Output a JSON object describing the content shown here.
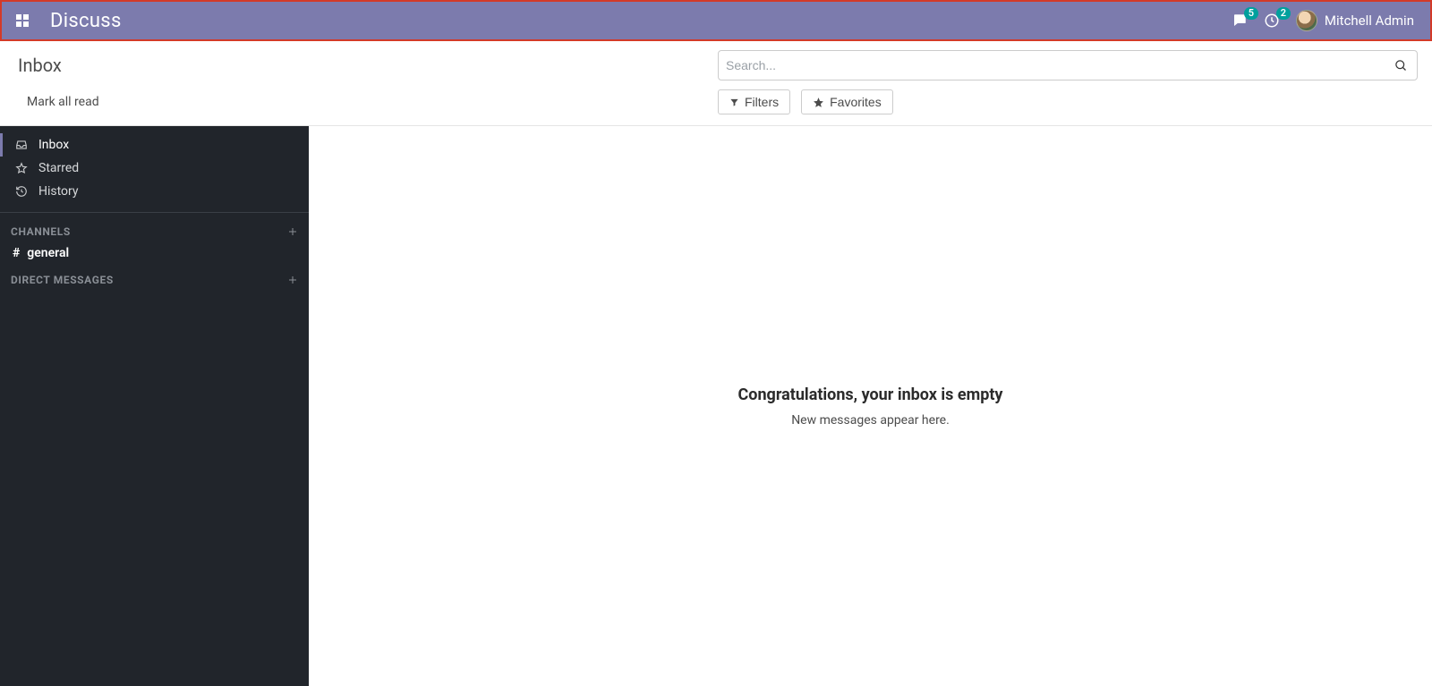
{
  "topnav": {
    "app_title": "Discuss",
    "messages_badge": "5",
    "activities_badge": "2",
    "username": "Mitchell Admin"
  },
  "control_panel": {
    "breadcrumb": "Inbox",
    "mark_all_read": "Mark all read",
    "search_placeholder": "Search...",
    "filters_label": "Filters",
    "favorites_label": "Favorites"
  },
  "sidebar": {
    "mailboxes": [
      {
        "label": "Inbox",
        "icon": "inbox"
      },
      {
        "label": "Starred",
        "icon": "star"
      },
      {
        "label": "History",
        "icon": "history"
      }
    ],
    "channels_header": "CHANNELS",
    "channels": [
      {
        "label": "general"
      }
    ],
    "dm_header": "DIRECT MESSAGES"
  },
  "content": {
    "empty_title": "Congratulations, your inbox is empty",
    "empty_sub": "New messages appear here."
  }
}
